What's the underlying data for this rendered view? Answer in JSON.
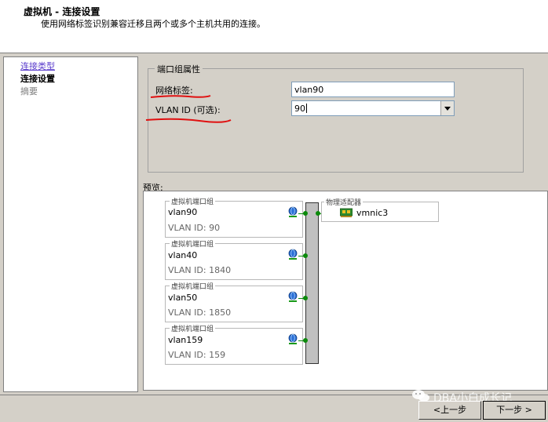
{
  "header": {
    "title": "虚拟机 - 连接设置",
    "subtitle": "使用网络标签识别兼容迁移且两个或多个主机共用的连接。"
  },
  "sidebar": {
    "items": [
      {
        "label": "连接类型",
        "state": "link"
      },
      {
        "label": "连接设置",
        "state": "current"
      },
      {
        "label": "摘要",
        "state": "disabled"
      }
    ]
  },
  "port_group_properties": {
    "legend": "端口组属性",
    "network_label": {
      "label": "网络标签:",
      "value": "vlan90"
    },
    "vlan_id": {
      "label": "VLAN ID (可选):",
      "value": "90"
    }
  },
  "preview": {
    "label": "预览:",
    "port_groups": [
      {
        "legend": "虚拟机端口组",
        "name": "vlan90",
        "vlan": "VLAN ID: 90"
      },
      {
        "legend": "虚拟机端口组",
        "name": "vlan40",
        "vlan": "VLAN ID: 1840"
      },
      {
        "legend": "虚拟机端口组",
        "name": "vlan50",
        "vlan": "VLAN ID: 1850"
      },
      {
        "legend": "虚拟机端口组",
        "name": "vlan159",
        "vlan": "VLAN ID: 159"
      }
    ],
    "physical_adapters": {
      "legend": "物理适配器",
      "nic": "vmnic3"
    }
  },
  "buttons": {
    "back": "<上一步",
    "next": "下一步 >"
  },
  "watermark": "DBA小白成长记",
  "colors": {
    "annotation_red": "#e01010",
    "link": "#5a3ccc",
    "port_green": "#0b8a0b"
  }
}
